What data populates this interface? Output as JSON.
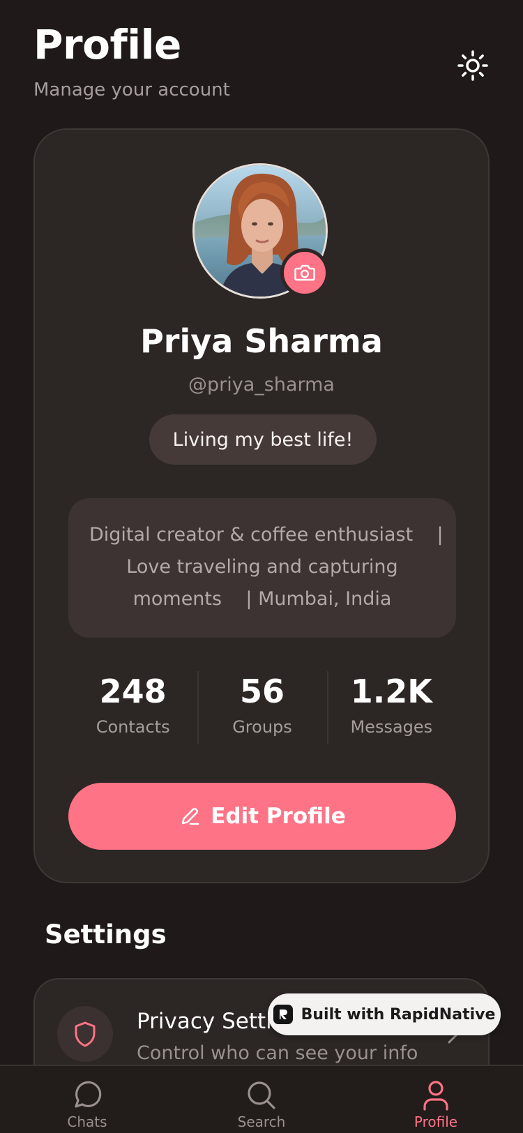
{
  "header": {
    "title": "Profile",
    "subtitle": "Manage your account",
    "theme_icon": "sun-icon"
  },
  "profile": {
    "name": "Priya Sharma",
    "handle": "@priya_sharma",
    "status": "Living my best life!",
    "bio_lines": [
      "Digital creator & coffee enthusiast    |",
      "Love traveling and capturing",
      "moments    | Mumbai, India"
    ],
    "camera_icon": "camera-icon",
    "stats": [
      {
        "value": "248",
        "label": "Contacts"
      },
      {
        "value": "56",
        "label": "Groups"
      },
      {
        "value": "1.2K",
        "label": "Messages"
      }
    ],
    "edit_label": "Edit Profile"
  },
  "settings": {
    "title": "Settings",
    "items": [
      {
        "title": "Privacy Settings",
        "description": "Control who can see your info",
        "icon": "shield-icon"
      }
    ]
  },
  "badge": {
    "label": "Built with RapidNative"
  },
  "nav": {
    "items": [
      {
        "label": "Chats",
        "icon": "chat-icon",
        "active": false
      },
      {
        "label": "Search",
        "icon": "search-icon",
        "active": false
      },
      {
        "label": "Profile",
        "icon": "user-icon",
        "active": true
      }
    ]
  },
  "colors": {
    "background": "#1f1a19",
    "card": "#2c2624",
    "accent": "#ff7386",
    "muted_text": "#a59d9b"
  }
}
